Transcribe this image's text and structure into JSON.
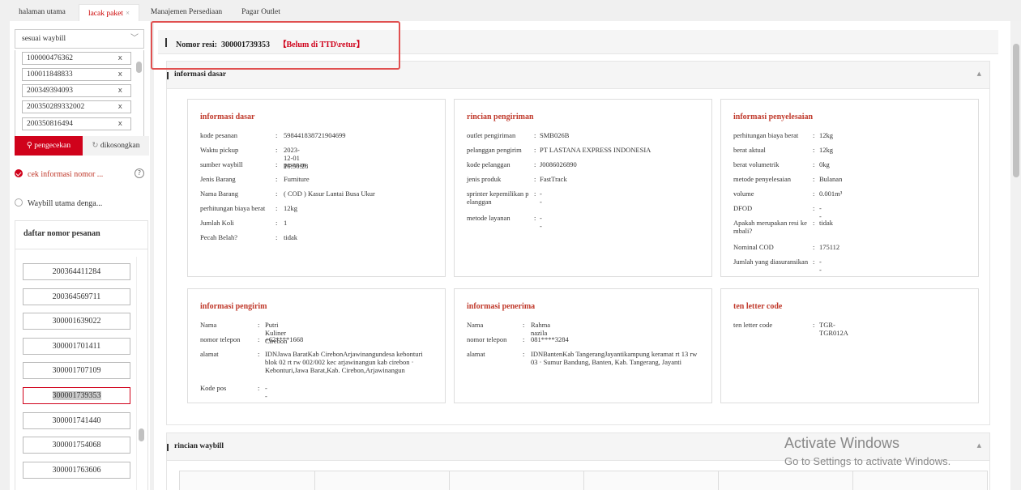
{
  "tabs": [
    {
      "label": "halaman utama",
      "active": false
    },
    {
      "label": "lacak paket",
      "active": true,
      "close": "×"
    },
    {
      "label": "Manajemen Persediaan",
      "active": false
    },
    {
      "label": "Pagar Outlet",
      "active": false
    }
  ],
  "sidebar": {
    "select_value": "sesuai waybill",
    "waybills": [
      "100000476362",
      "100011848833",
      "200349394093",
      "200350289332002",
      "200350816494"
    ],
    "remove_glyph": "x",
    "search_label": "pengecekan",
    "clear_label": "dikosongkan",
    "radio_1": "cek informasi nomor ...",
    "radio_2": "Waybill utama denga...",
    "help": "?",
    "order_list_title": "daftar nomor pesanan",
    "orders": [
      "200364411284",
      "200364569711",
      "300001639022",
      "300001701411",
      "300001707109",
      "300001739353",
      "300001741440",
      "300001754068",
      "300001763606"
    ],
    "selected_order": "300001739353"
  },
  "header": {
    "resi_label": "Nomor resi:",
    "resi_number": "300001739353",
    "resi_status": "【Belum di TTD\\retur】"
  },
  "section_basic": {
    "title": "informasi dasar",
    "caret": "▲"
  },
  "card_basic": {
    "title": "informasi dasar",
    "rows": [
      {
        "label": "kode pesanan",
        "value": "598441838721904699"
      },
      {
        "label": "Waktu pickup",
        "value": "2023-12-01 16:56:28"
      },
      {
        "label": "sumber waybill",
        "value": "pesanan"
      },
      {
        "label": "Jenis Barang",
        "value": "Furniture"
      },
      {
        "label": "Nama Barang",
        "value": "( COD ) Kasur Lantai Busa Ukur"
      },
      {
        "label": "perhitungan biaya berat",
        "value": "12kg"
      },
      {
        "label": "Jumlah Koli",
        "value": "1"
      },
      {
        "label": "Pecah Belah?",
        "value": "tidak"
      }
    ]
  },
  "card_shipping": {
    "title": "rincian pengiriman",
    "rows": [
      {
        "label": "outlet pengiriman",
        "value": "SMB026B"
      },
      {
        "label": "pelanggan pengirim",
        "value": "PT LASTANA EXPRESS INDONESIA"
      },
      {
        "label": "kode pelanggan",
        "value": "J0086026890"
      },
      {
        "label": "jenis produk",
        "value": "FastTrack"
      },
      {
        "label": "sprinter kepemilikan p\nelanggan",
        "value": "--"
      },
      {
        "label": "metode layanan",
        "value": "--"
      }
    ]
  },
  "card_settlement": {
    "title": "informasi penyelesaian",
    "rows": [
      {
        "label": "perhitungan biaya berat",
        "value": "12kg"
      },
      {
        "label": "berat aktual",
        "value": "12kg"
      },
      {
        "label": "berat volumetrik",
        "value": "0kg"
      },
      {
        "label": "metode penyelesaian",
        "value": "Bulanan"
      },
      {
        "label": "volume",
        "value": "0.001m³"
      },
      {
        "label": "DFOD",
        "value": "--"
      },
      {
        "label": "Apakah merupakan resi ke\nmbali?",
        "value": "tidak"
      },
      {
        "label": "Nominal COD",
        "value": "175112"
      },
      {
        "label": "Jumlah yang diasuransikan",
        "value": "--"
      }
    ]
  },
  "card_sender": {
    "title": "informasi pengirim",
    "rows": [
      {
        "label": "Nama",
        "value": "Putri Kuliner Cirebon"
      },
      {
        "label": "nomor telepon",
        "value": "+62****1668"
      },
      {
        "label": "alamat",
        "value": "IDNJawa BaratKab CirebonArjawinangundesa kebonturi blok 02 rt rw 002/002 kec arjawinangun kab cirebon · Kebonturi,Jawa Barat,Kab. Cirebon,Arjawinangun"
      },
      {
        "label": "Kode pos",
        "value": "--"
      }
    ]
  },
  "card_receiver": {
    "title": "informasi penerima",
    "rows": [
      {
        "label": "Nama",
        "value": "Rahma nazila"
      },
      {
        "label": "nomor telepon",
        "value": "081****3284"
      },
      {
        "label": "alamat",
        "value": "IDNBantenKab TangerangJayantikampung keramat rt 13 rw 03 · Sumur Bandung, Banten, Kab. Tangerang, Jayanti"
      }
    ]
  },
  "card_tlc": {
    "title": "ten letter code",
    "rows": [
      {
        "label": "ten letter code",
        "value": "TGR-TGR012A"
      }
    ]
  },
  "section_waybill": {
    "title": "rincian waybill",
    "caret": "▲"
  },
  "windows_watermark": {
    "line1": "Activate Windows",
    "line2": "Go to Settings to activate Windows."
  }
}
